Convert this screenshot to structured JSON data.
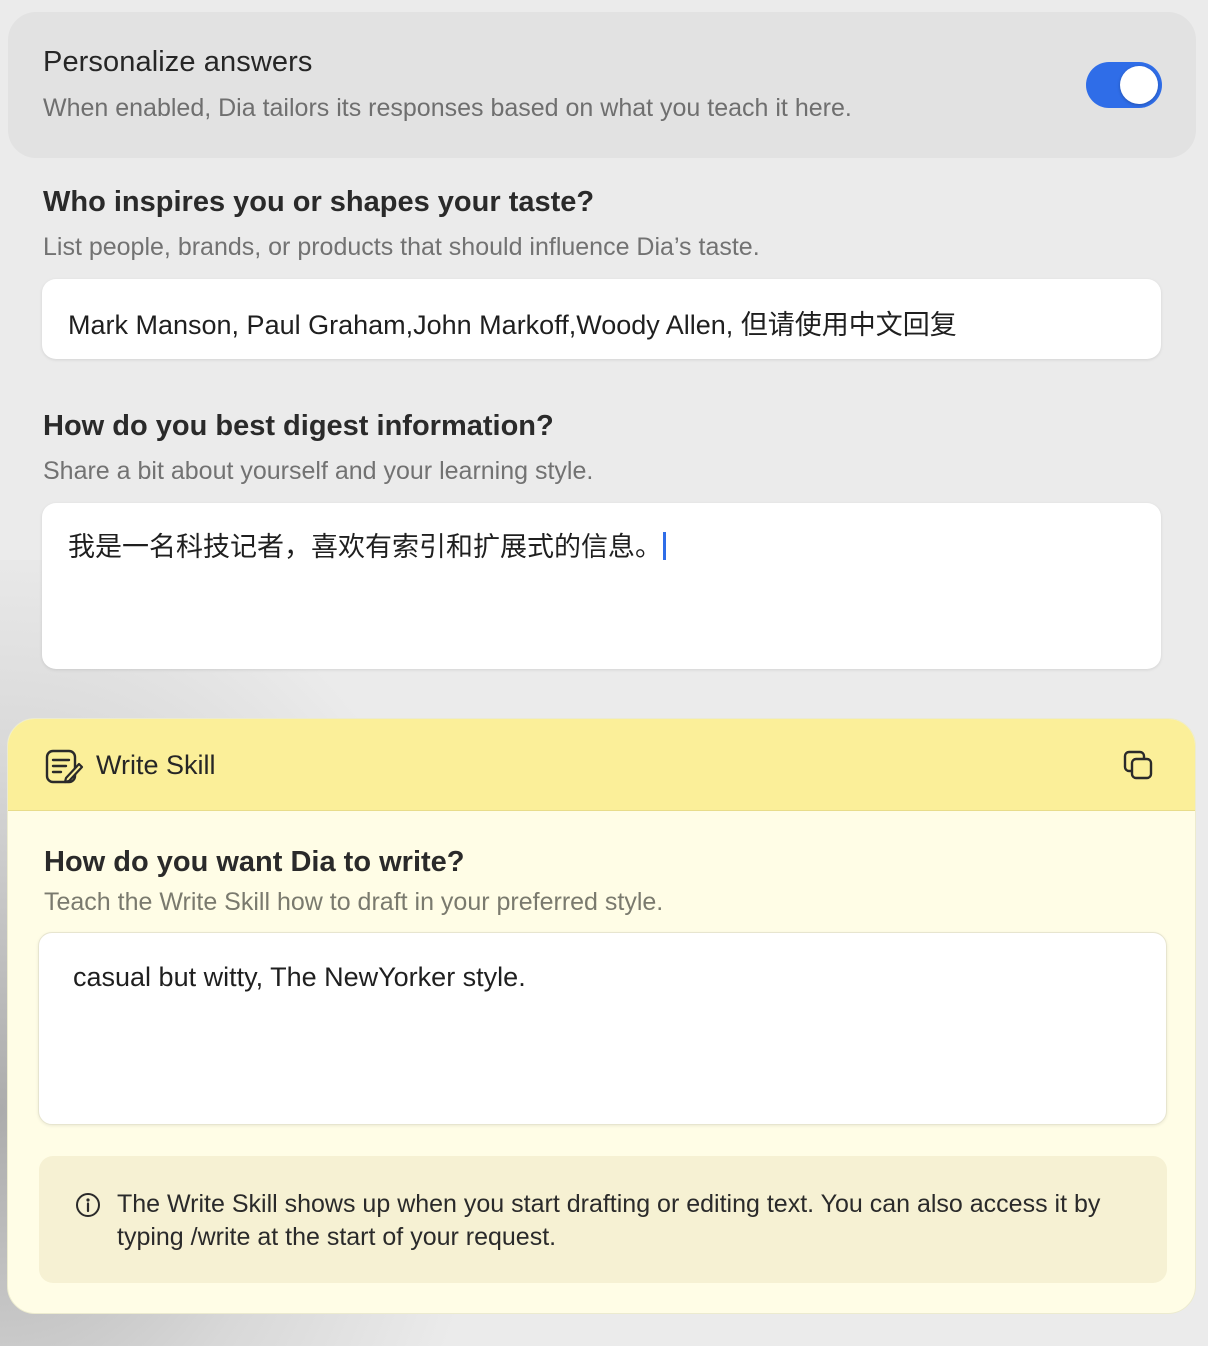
{
  "personalize": {
    "title": "Personalize answers",
    "subtitle": "When enabled, Dia tailors its responses based on what you teach it here.",
    "enabled": true
  },
  "inspires": {
    "title": "Who inspires you or shapes your taste?",
    "subtitle": "List people, brands, or products that should influence Dia’s taste.",
    "value": "Mark Manson, Paul Graham,John Markoff,Woody Allen, 但请使用中文回复"
  },
  "digest": {
    "title": "How do you best digest information?",
    "subtitle": "Share a bit about yourself and your learning style.",
    "value": "我是一名科技记者，喜欢有索引和扩展式的信息。"
  },
  "write_skill": {
    "header_title": "Write Skill",
    "header_icon": "write-skill-icon",
    "copy_icon": "copy-icon",
    "question_title": "How do you want Dia to write?",
    "question_subtitle": "Teach the Write Skill how to draft in your preferred style.",
    "value": "casual but witty, The NewYorker style.",
    "info_icon": "info-icon",
    "info_text": "The Write Skill shows up when you start drafting or editing text. You can also access it by typing /write at the start of your request."
  },
  "colors": {
    "accent": "#2f6de8",
    "skill_header": "#fbef99",
    "skill_body": "#fffde6",
    "background": "#ebebeb"
  }
}
